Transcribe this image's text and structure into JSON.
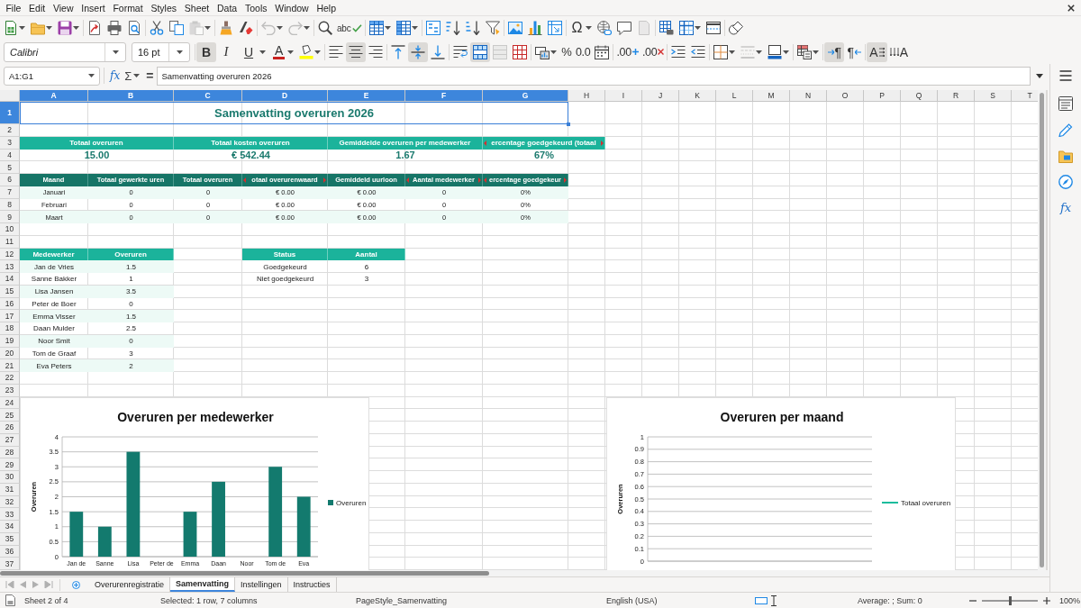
{
  "menu_bar": [
    "File",
    "Edit",
    "View",
    "Insert",
    "Format",
    "Styles",
    "Sheet",
    "Data",
    "Tools",
    "Window",
    "Help"
  ],
  "standard_toolbar": {
    "paste": {
      "disabled": true
    },
    "undo": {
      "disabled": true
    },
    "redo": {
      "disabled": true
    },
    "spelling": {
      "glyph": "abc"
    },
    "special_character": {
      "glyph": "Ω"
    },
    "header_footer": {
      "disabled": true
    }
  },
  "format_toolbar": {
    "font_name": "Calibri",
    "font_size": "16 pt",
    "bold": {
      "glyph": "B",
      "on": true
    },
    "italic": {
      "glyph": "I",
      "on": false
    },
    "underline": {
      "glyph": "U",
      "on": false
    },
    "font_color": {
      "glyph": "A"
    },
    "align_left": {
      "on": false
    },
    "align_center": {
      "on": true
    },
    "align_right": {
      "on": false
    },
    "align_top": {
      "on": false
    },
    "align_middle": {
      "on": true
    },
    "align_bottom": {
      "on": false
    },
    "wrap_text": {
      "on": false
    },
    "merge_and_center": {
      "on": true
    },
    "merge_cells": {
      "disabled": true
    },
    "percent": {
      "glyph": "%"
    },
    "number": {
      "glyph": "0.0"
    },
    "add_decimal": {
      "glyph": ".00"
    },
    "delete_decimal": {
      "glyph": ".00"
    },
    "border_style": {
      "disabled": true
    },
    "left_to_right": {
      "glyph": "¶",
      "on": true
    },
    "right_to_left": {
      "glyph": "¶",
      "on": false
    },
    "text_horizontal": {
      "glyph": "A",
      "on": true
    },
    "text_vertical": {
      "glyph": "A",
      "on": false
    }
  },
  "formula_bar": {
    "name_box": "A1:G1",
    "function_glyph": "fx",
    "sum_glyph": "Σ",
    "equals_glyph": "=",
    "content": "Samenvatting overuren 2026"
  },
  "sidebar": {
    "functions_glyph": "fx"
  },
  "columns": [
    {
      "label": "A",
      "selected": true
    },
    {
      "label": "B",
      "selected": true
    },
    {
      "label": "C",
      "selected": true
    },
    {
      "label": "D",
      "selected": true
    },
    {
      "label": "E",
      "selected": true
    },
    {
      "label": "F",
      "selected": true
    },
    {
      "label": "G",
      "selected": true
    },
    {
      "label": "H",
      "selected": false
    },
    {
      "label": "I",
      "selected": false
    },
    {
      "label": "J",
      "selected": false
    },
    {
      "label": "K",
      "selected": false
    },
    {
      "label": "L",
      "selected": false
    },
    {
      "label": "M",
      "selected": false
    },
    {
      "label": "N",
      "selected": false
    },
    {
      "label": "O",
      "selected": false
    },
    {
      "label": "P",
      "selected": false
    },
    {
      "label": "Q",
      "selected": false
    },
    {
      "label": "R",
      "selected": false
    },
    {
      "label": "S",
      "selected": false
    },
    {
      "label": "T",
      "selected": false
    }
  ],
  "rows": [
    {
      "label": "1",
      "selected": true
    },
    {
      "label": "2",
      "selected": false
    },
    {
      "label": "3",
      "selected": false
    },
    {
      "label": "4",
      "selected": false
    },
    {
      "label": "5",
      "selected": false
    },
    {
      "label": "6",
      "selected": false
    },
    {
      "label": "7",
      "selected": false
    },
    {
      "label": "8",
      "selected": false
    },
    {
      "label": "9",
      "selected": false
    },
    {
      "label": "10",
      "selected": false
    },
    {
      "label": "11",
      "selected": false
    },
    {
      "label": "12",
      "selected": false
    },
    {
      "label": "13",
      "selected": false
    },
    {
      "label": "14",
      "selected": false
    },
    {
      "label": "15",
      "selected": false
    },
    {
      "label": "16",
      "selected": false
    },
    {
      "label": "17",
      "selected": false
    },
    {
      "label": "18",
      "selected": false
    },
    {
      "label": "19",
      "selected": false
    },
    {
      "label": "20",
      "selected": false
    },
    {
      "label": "21",
      "selected": false
    },
    {
      "label": "22",
      "selected": false
    },
    {
      "label": "23",
      "selected": false
    },
    {
      "label": "24",
      "selected": false
    },
    {
      "label": "25",
      "selected": false
    },
    {
      "label": "26",
      "selected": false
    },
    {
      "label": "27",
      "selected": false
    },
    {
      "label": "28",
      "selected": false
    },
    {
      "label": "29",
      "selected": false
    },
    {
      "label": "30",
      "selected": false
    },
    {
      "label": "31",
      "selected": false
    },
    {
      "label": "32",
      "selected": false
    },
    {
      "label": "33",
      "selected": false
    },
    {
      "label": "34",
      "selected": false
    },
    {
      "label": "35",
      "selected": false
    },
    {
      "label": "36",
      "selected": false
    },
    {
      "label": "37",
      "selected": false
    }
  ],
  "title": {
    "text": "Samenvatting overuren 2026",
    "selected": true
  },
  "kpis": [
    {
      "label": "Totaal overuren",
      "clipped": false,
      "value": "15.00"
    },
    {
      "label": "Totaal kosten overuren",
      "clipped": false,
      "value": "€ 542.44"
    },
    {
      "label": "Gemiddelde overuren per medewerker",
      "clipped": false,
      "value": "1.67"
    },
    {
      "label": "ercentage goedgekeurd (totaal",
      "clipped": true,
      "value": "67%"
    }
  ],
  "month_table": {
    "headers": [
      {
        "text": "Maand",
        "clipped": false
      },
      {
        "text": "Totaal gewerkte uren",
        "clipped": false
      },
      {
        "text": "Totaal overuren",
        "clipped": false
      },
      {
        "text": "otaal overurenwaard",
        "clipped": true
      },
      {
        "text": "Gemiddeld uurloon",
        "clipped": false
      },
      {
        "text": "Aantal medewerker",
        "clipped": true
      },
      {
        "text": "ercentage goedgekeur",
        "clipped": true
      }
    ],
    "rows": [
      [
        "Januari",
        "0",
        "0",
        "€ 0.00",
        "€ 0.00",
        "0",
        "0%"
      ],
      [
        "Februari",
        "0",
        "0",
        "€ 0.00",
        "€ 0.00",
        "0",
        "0%"
      ],
      [
        "Maart",
        "0",
        "0",
        "€ 0.00",
        "€ 0.00",
        "0",
        "0%"
      ]
    ]
  },
  "employee_table": {
    "headers": [
      "Medewerker",
      "Overuren"
    ],
    "rows": [
      [
        "Jan de Vries",
        "1.5"
      ],
      [
        "Sanne Bakker",
        "1"
      ],
      [
        "Lisa Jansen",
        "3.5"
      ],
      [
        "Peter de Boer",
        "0"
      ],
      [
        "Emma Visser",
        "1.5"
      ],
      [
        "Daan Mulder",
        "2.5"
      ],
      [
        "Noor Smit",
        "0"
      ],
      [
        "Tom de Graaf",
        "3"
      ],
      [
        "Eva Peters",
        "2"
      ]
    ]
  },
  "status_table": {
    "headers": [
      "Status",
      "Aantal"
    ],
    "rows": [
      [
        "Goedgekeurd",
        "6"
      ],
      [
        "Niet goedgekeurd",
        "3"
      ]
    ]
  },
  "charts": [
    {
      "chart_data": {
        "type": "bar",
        "title": "Overuren per medewerker",
        "ylabel": "Overuren",
        "categories": [
          "Jan de",
          "Sanne",
          "Lisa",
          "Peter de",
          "Emma",
          "Daan",
          "Noor",
          "Tom de",
          "Eva"
        ],
        "series": [
          {
            "name": "Overuren",
            "color": "#137a6e",
            "values": [
              1.5,
              1,
              3.5,
              0,
              1.5,
              2.5,
              0,
              3,
              2
            ]
          }
        ],
        "ylim": [
          0,
          4
        ],
        "yticks": [
          0,
          0.5,
          1,
          1.5,
          2,
          2.5,
          3,
          3.5,
          4
        ],
        "grid": true
      }
    },
    {
      "chart_data": {
        "type": "line",
        "title": "Overuren per maand",
        "ylabel": "Overuren",
        "series": [
          {
            "name": "Totaal overuren",
            "color": "#1abc9c"
          }
        ],
        "ylim": [
          0,
          1
        ],
        "yticks": [
          0,
          0.1,
          0.2,
          0.3,
          0.4,
          0.5,
          0.6,
          0.7,
          0.8,
          0.9,
          1
        ],
        "grid": true
      }
    }
  ],
  "sheet_tabs": [
    {
      "label": "Overurenregistratie",
      "selected": false
    },
    {
      "label": "Samenvatting",
      "selected": true
    },
    {
      "label": "Instellingen",
      "selected": false
    },
    {
      "label": "Instructies",
      "selected": false
    }
  ],
  "status_bar": {
    "sheet": "Sheet 2 of 4",
    "selection": "Selected: 1 row, 7 columns",
    "page_style": "PageStyle_Samenvatting",
    "language": "English (USA)",
    "summary": "Average: ; Sum: 0",
    "zoom_slider": {
      "level": 0.5
    },
    "zoom": "100%"
  }
}
